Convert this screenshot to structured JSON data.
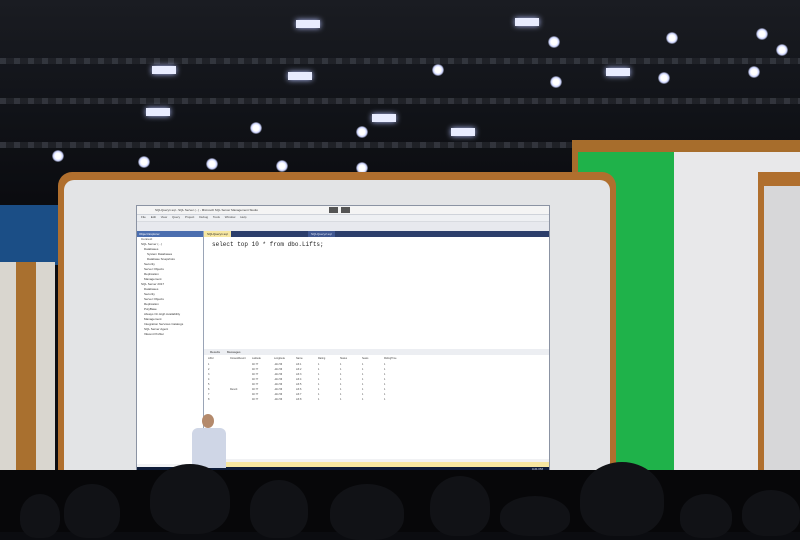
{
  "scene": {
    "description_tag": "stage-presentation",
    "accent_green": "#1fb24a",
    "frame_brown": "#b06f2e"
  },
  "ssms": {
    "window_title": "SQLQuery1.sql - SQL Server (...) - Microsoft SQL Server Management Studio",
    "menu": [
      "File",
      "Edit",
      "View",
      "Query",
      "Project",
      "Debug",
      "Tools",
      "Window",
      "Help"
    ],
    "object_explorer": {
      "header": "Object Explorer",
      "connect_label": "Connect",
      "items": [
        "SQL Server (...)",
        "Databases",
        "System Databases",
        "Database Snapshots",
        "Security",
        "Server Objects",
        "Replication",
        "Management",
        "SQL Server 2017",
        "Databases",
        "Security",
        "Server Objects",
        "Replication",
        "PolyBase",
        "Always On High Availability",
        "Management",
        "Integration Services Catalogs",
        "SQL Server Agent",
        "XEvent Profiler"
      ]
    },
    "tabs": [
      "SQLQuery1.sql",
      "SQLQuery2.sql"
    ],
    "query_text": "select top 10 * from dbo.Lifts;",
    "results_tabs": [
      "Results",
      "Messages"
    ],
    "result_columns": [
      "LiftId",
      "ClosestResort",
      "Latitude",
      "Longitude",
      "Name",
      "Rating",
      "Status",
      "Seats",
      "RidingTime"
    ],
    "result_rows": [
      [
        "1",
        "",
        "40.77",
        "-111.56",
        "Lift 1",
        "1",
        "1",
        "1",
        "1"
      ],
      [
        "2",
        "",
        "40.77",
        "-111.56",
        "Lift 2",
        "1",
        "1",
        "1",
        "1"
      ],
      [
        "3",
        "",
        "40.77",
        "-111.56",
        "Lift 3",
        "1",
        "1",
        "1",
        "1"
      ],
      [
        "4",
        "",
        "40.77",
        "-111.56",
        "Lift 4",
        "1",
        "1",
        "1",
        "1"
      ],
      [
        "5",
        "",
        "40.77",
        "-111.56",
        "Lift 5",
        "1",
        "1",
        "1",
        "1"
      ],
      [
        "6",
        "Resort",
        "40.77",
        "-111.56",
        "Lift 6",
        "1",
        "1",
        "1",
        "1"
      ],
      [
        "7",
        "",
        "40.77",
        "-111.56",
        "Lift 7",
        "1",
        "1",
        "1",
        "1"
      ],
      [
        "8",
        "",
        "40.77",
        "-111.56",
        "Lift 8",
        "1",
        "1",
        "1",
        "1"
      ]
    ],
    "taskbar": {
      "time": "4:21 PM",
      "date": "4/14/2018"
    }
  }
}
